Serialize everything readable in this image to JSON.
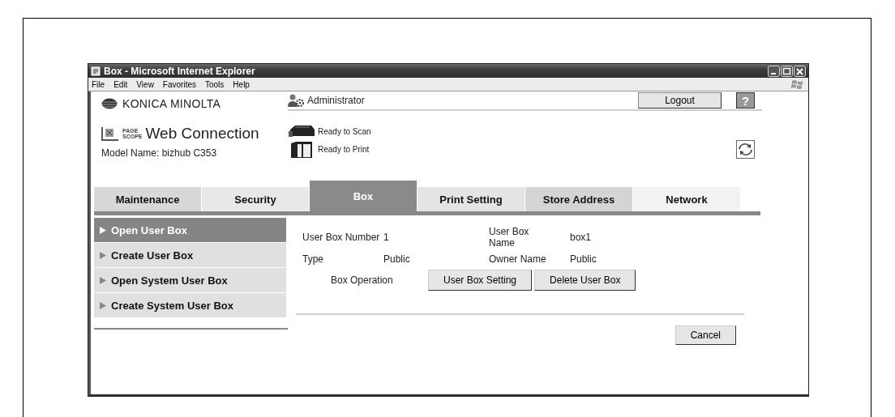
{
  "window": {
    "title": "Box - Microsoft Internet Explorer"
  },
  "menu": [
    "File",
    "Edit",
    "View",
    "Favorites",
    "Tools",
    "Help"
  ],
  "header": {
    "brand": "KONICA MINOLTA",
    "product_prefix": [
      "PAGE",
      "SCOPE"
    ],
    "product": "Web Connection",
    "model": "Model Name: bizhub C353",
    "user": "Administrator",
    "logout": "Logout",
    "help": "?",
    "status": [
      "Ready to Scan",
      "Ready to Print"
    ]
  },
  "tabs": [
    {
      "label": "Maintenance",
      "selected": false
    },
    {
      "label": "Security",
      "selected": false
    },
    {
      "label": "Box",
      "selected": true
    },
    {
      "label": "Print Setting",
      "selected": false
    },
    {
      "label": "Store Address",
      "selected": false
    },
    {
      "label": "Network",
      "selected": false
    }
  ],
  "sidebar": {
    "items": [
      {
        "label": "Open User Box",
        "selected": true
      },
      {
        "label": "Create User Box",
        "selected": false
      },
      {
        "label": "Open System User Box",
        "selected": false
      },
      {
        "label": "Create System User Box",
        "selected": false
      }
    ]
  },
  "box": {
    "fields": [
      {
        "label": "User Box Number",
        "value": "1"
      },
      {
        "label": "User Box Name",
        "value": "box1"
      },
      {
        "label": "Type",
        "value": "Public"
      },
      {
        "label": "Owner Name",
        "value": "Public"
      }
    ],
    "operation": {
      "label": "Box Operation",
      "buttons": [
        "User Box Setting",
        "Delete User Box"
      ]
    },
    "cancel": "Cancel"
  }
}
